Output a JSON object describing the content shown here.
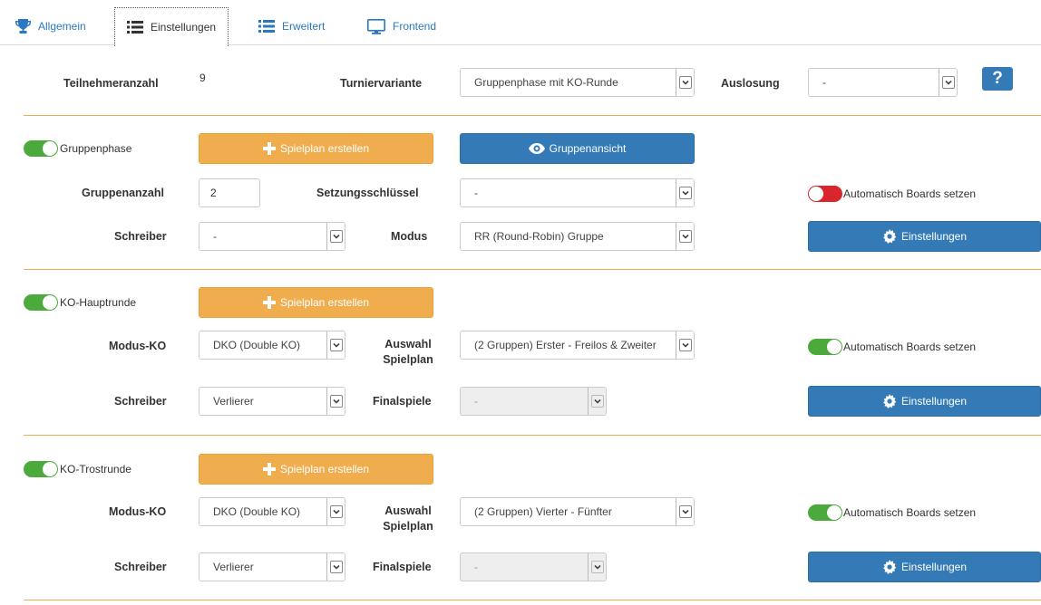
{
  "tabs": [
    {
      "label": "Allgemein",
      "icon": "trophy-icon"
    },
    {
      "label": "Einstellungen",
      "icon": "list-icon"
    },
    {
      "label": "Erweitert",
      "icon": "list-icon"
    },
    {
      "label": "Frontend",
      "icon": "monitor-icon"
    }
  ],
  "active_tab": "Einstellungen",
  "colors": {
    "accent_blue": "#337ab7",
    "accent_orange": "#f0ad4e",
    "toggle_on": "#4caa3d",
    "toggle_off": "#d9262d",
    "link": "#2a78c1"
  },
  "top": {
    "participants_label": "Teilnehmeranzahl",
    "participants_value": "9",
    "variant_label": "Turniervariante",
    "variant_value": "Gruppenphase mit KO-Runde",
    "draw_label": "Auslosung",
    "draw_value": "-",
    "help_label": "?"
  },
  "group": {
    "toggle_label": "Gruppenphase",
    "toggle_on": true,
    "create_button": "Spielplan erstellen",
    "view_button": "Gruppenansicht",
    "count_label": "Gruppenanzahl",
    "count_value": "2",
    "seeding_label": "Setzungsschlüssel",
    "seeding_value": "-",
    "auto_boards_label": "Automatisch Boards setzen",
    "auto_boards_on": false,
    "writer_label": "Schreiber",
    "writer_value": "-",
    "mode_label": "Modus",
    "mode_value": "RR (Round-Robin) Gruppe",
    "settings_button": "Einstellungen"
  },
  "ko_main": {
    "toggle_label": "KO-Hauptrunde",
    "toggle_on": true,
    "create_button": "Spielplan erstellen",
    "mode_label": "Modus-KO",
    "mode_value": "DKO (Double KO)",
    "plan_label": "Auswahl Spielplan",
    "plan_value": "(2 Gruppen) Erster - Freilos & Zweiter",
    "auto_boards_label": "Automatisch Boards setzen",
    "auto_boards_on": true,
    "writer_label": "Schreiber",
    "writer_value": "Verlierer",
    "finals_label": "Finalspiele",
    "finals_value": "-",
    "settings_button": "Einstellungen"
  },
  "ko_consolation": {
    "toggle_label": "KO-Trostrunde",
    "toggle_on": true,
    "create_button": "Spielplan erstellen",
    "mode_label": "Modus-KO",
    "mode_value": "DKO (Double KO)",
    "plan_label": "Auswahl Spielplan",
    "plan_value": "(2 Gruppen) Vierter - Fünfter",
    "auto_boards_label": "Automatisch Boards setzen",
    "auto_boards_on": true,
    "writer_label": "Schreiber",
    "writer_value": "Verlierer",
    "finals_label": "Finalspiele",
    "finals_value": "-",
    "settings_button": "Einstellungen"
  }
}
